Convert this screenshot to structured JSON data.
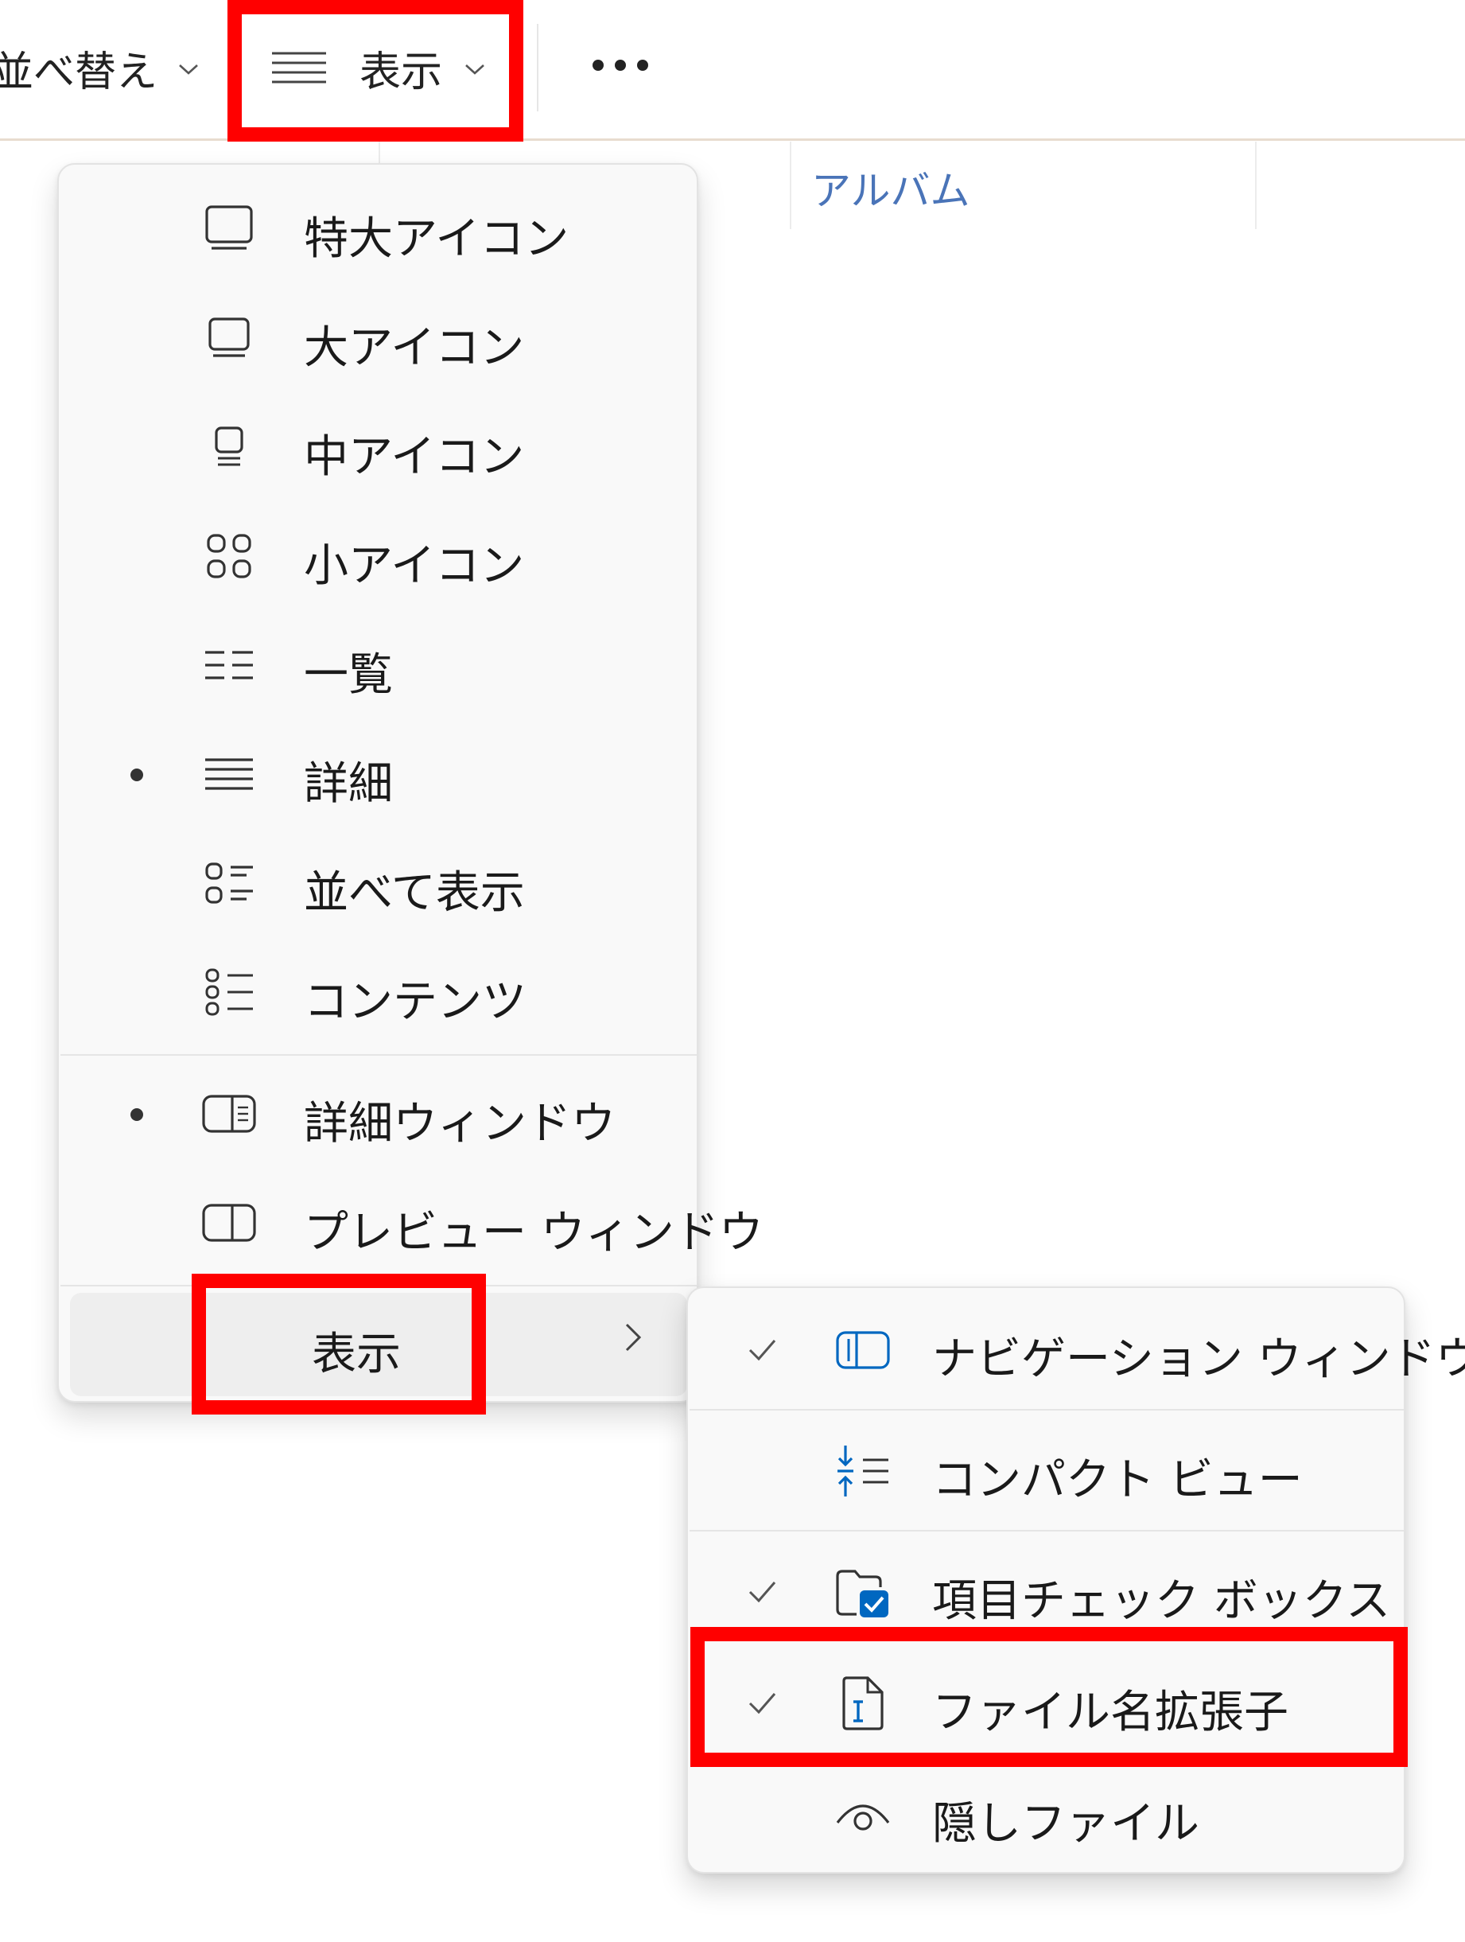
{
  "toolbar": {
    "sort_label": "並べ替え",
    "view_label": "表示",
    "more_label": "..."
  },
  "columns": {
    "album": "アルバム"
  },
  "view_menu": {
    "items": [
      {
        "label": "特大アイコン",
        "icon": "extra-large-icons-icon",
        "selected": false
      },
      {
        "label": "大アイコン",
        "icon": "large-icons-icon",
        "selected": false
      },
      {
        "label": "中アイコン",
        "icon": "medium-icons-icon",
        "selected": false
      },
      {
        "label": "小アイコン",
        "icon": "small-icons-icon",
        "selected": false
      },
      {
        "label": "一覧",
        "icon": "list-icon",
        "selected": false
      },
      {
        "label": "詳細",
        "icon": "details-icon",
        "selected": true
      },
      {
        "label": "並べて表示",
        "icon": "tiles-icon",
        "selected": false
      },
      {
        "label": "コンテンツ",
        "icon": "content-icon",
        "selected": false
      }
    ],
    "pane_items": [
      {
        "label": "詳細ウィンドウ",
        "icon": "details-pane-icon",
        "selected": true
      },
      {
        "label": "プレビュー ウィンドウ",
        "icon": "preview-pane-icon",
        "selected": false
      }
    ],
    "show_label": "表示"
  },
  "show_submenu": {
    "items": [
      {
        "label": "ナビゲーション ウィンドウ",
        "icon": "navigation-pane-icon",
        "checked": true
      },
      {
        "label": "コンパクト ビュー",
        "icon": "compact-view-icon",
        "checked": false
      },
      {
        "label": "項目チェック ボックス",
        "icon": "item-checkbox-icon",
        "checked": true
      },
      {
        "label": "ファイル名拡張子",
        "icon": "file-extension-icon",
        "checked": true
      },
      {
        "label": "隠しファイル",
        "icon": "hidden-items-icon",
        "checked": false
      }
    ]
  },
  "colors": {
    "highlight": "#ff0000",
    "accent": "#0067c0",
    "column_header_text": "#4a74b8"
  }
}
